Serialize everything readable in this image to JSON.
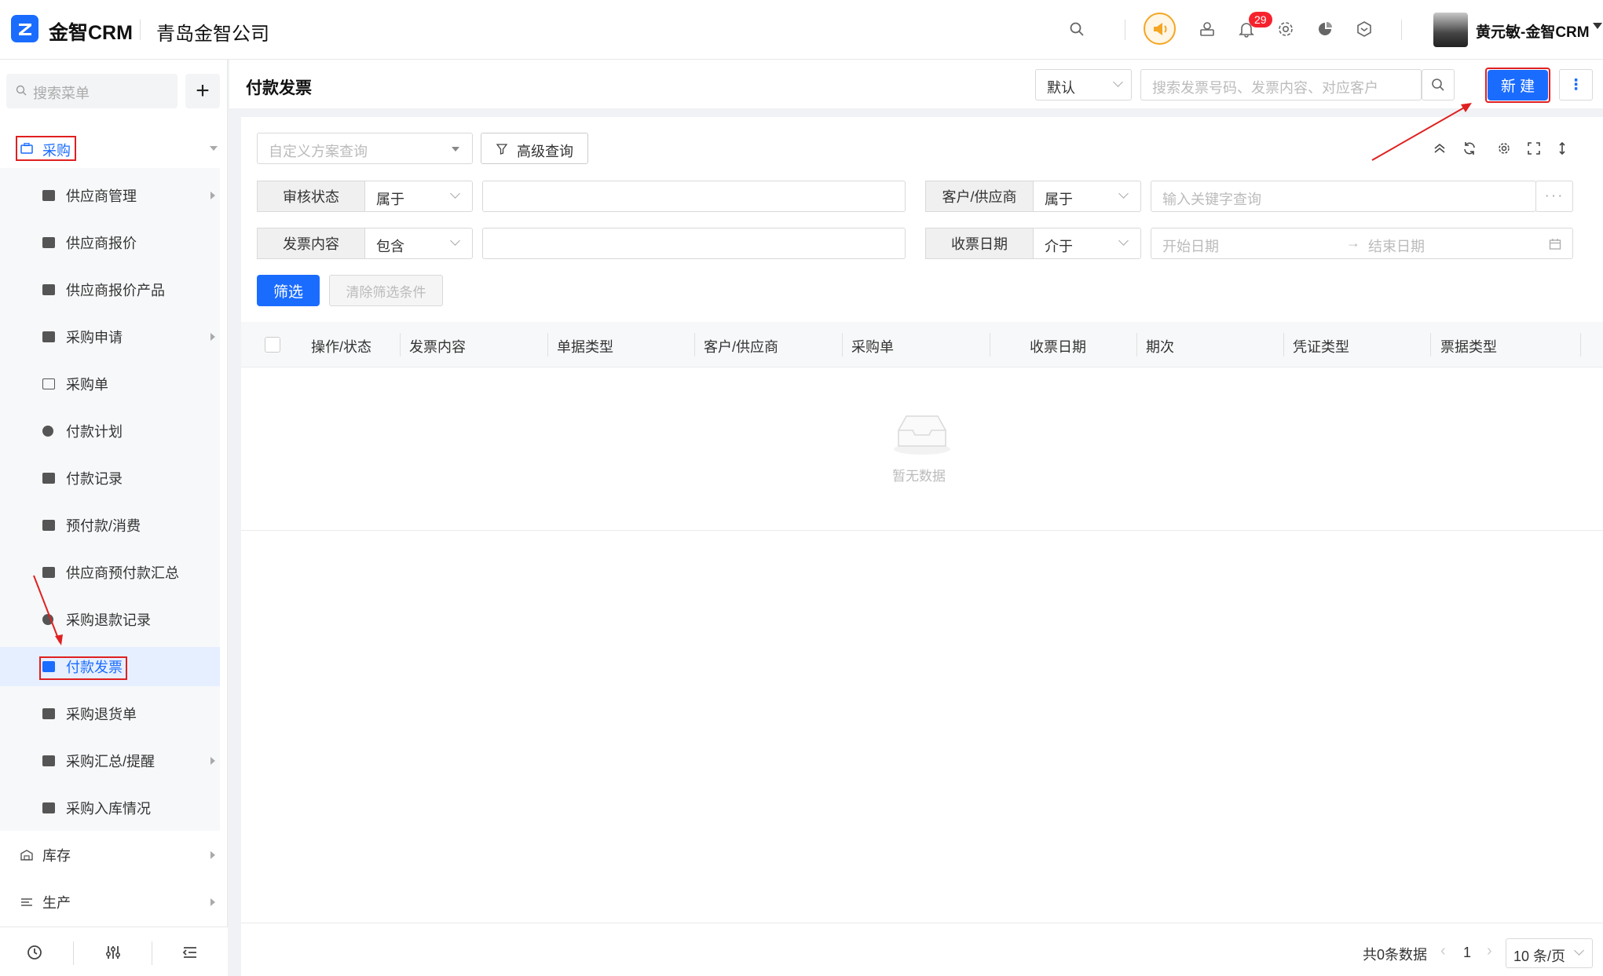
{
  "app": {
    "logo_text": "金智CRM",
    "company": "青岛金智公司"
  },
  "topbar": {
    "notification_count": "29",
    "user_name": "黄元敏-金智CRM"
  },
  "sidebar": {
    "search_placeholder": "搜索菜单",
    "section": "采购",
    "items": [
      {
        "label": "供应商管理",
        "arrow": true
      },
      {
        "label": "供应商报价"
      },
      {
        "label": "供应商报价产品"
      },
      {
        "label": "采购申请",
        "arrow": true
      },
      {
        "label": "采购单"
      },
      {
        "label": "付款计划"
      },
      {
        "label": "付款记录"
      },
      {
        "label": "预付款/消费"
      },
      {
        "label": "供应商预付款汇总"
      },
      {
        "label": "采购退款记录"
      },
      {
        "label": "付款发票",
        "active": true
      },
      {
        "label": "采购退货单"
      },
      {
        "label": "采购汇总/提醒",
        "arrow": true
      },
      {
        "label": "采购入库情况"
      }
    ],
    "other_sections": [
      "库存",
      "生产"
    ]
  },
  "header": {
    "title": "付款发票",
    "view_select": "默认",
    "search_placeholder": "搜索发票号码、发票内容、对应客户",
    "new_button": "新 建",
    "more_button": "⋮"
  },
  "filters": {
    "scheme_placeholder": "自定义方案查询",
    "advanced_button": "高级查询",
    "rows": [
      {
        "label": "审核状态",
        "op": "属于",
        "value": ""
      },
      {
        "label": "客户/供应商",
        "op": "属于",
        "value_placeholder": "输入关键字查询"
      },
      {
        "label": "发票内容",
        "op": "包含",
        "value": ""
      },
      {
        "label": "收票日期",
        "op": "介于",
        "start_placeholder": "开始日期",
        "end_placeholder": "结束日期"
      }
    ],
    "filter_button": "筛选",
    "clear_button": "清除筛选条件"
  },
  "table": {
    "columns": [
      "操作/状态",
      "发票内容",
      "单据类型",
      "客户/供应商",
      "采购单",
      "收票日期",
      "期次",
      "凭证类型",
      "票据类型"
    ],
    "empty_text": "暂无数据"
  },
  "pagination": {
    "total_text": "共0条数据",
    "current_page": "1",
    "page_size": "10 条/页"
  },
  "colors": {
    "accent": "#1a6cff",
    "annotation_red": "#e02020"
  }
}
